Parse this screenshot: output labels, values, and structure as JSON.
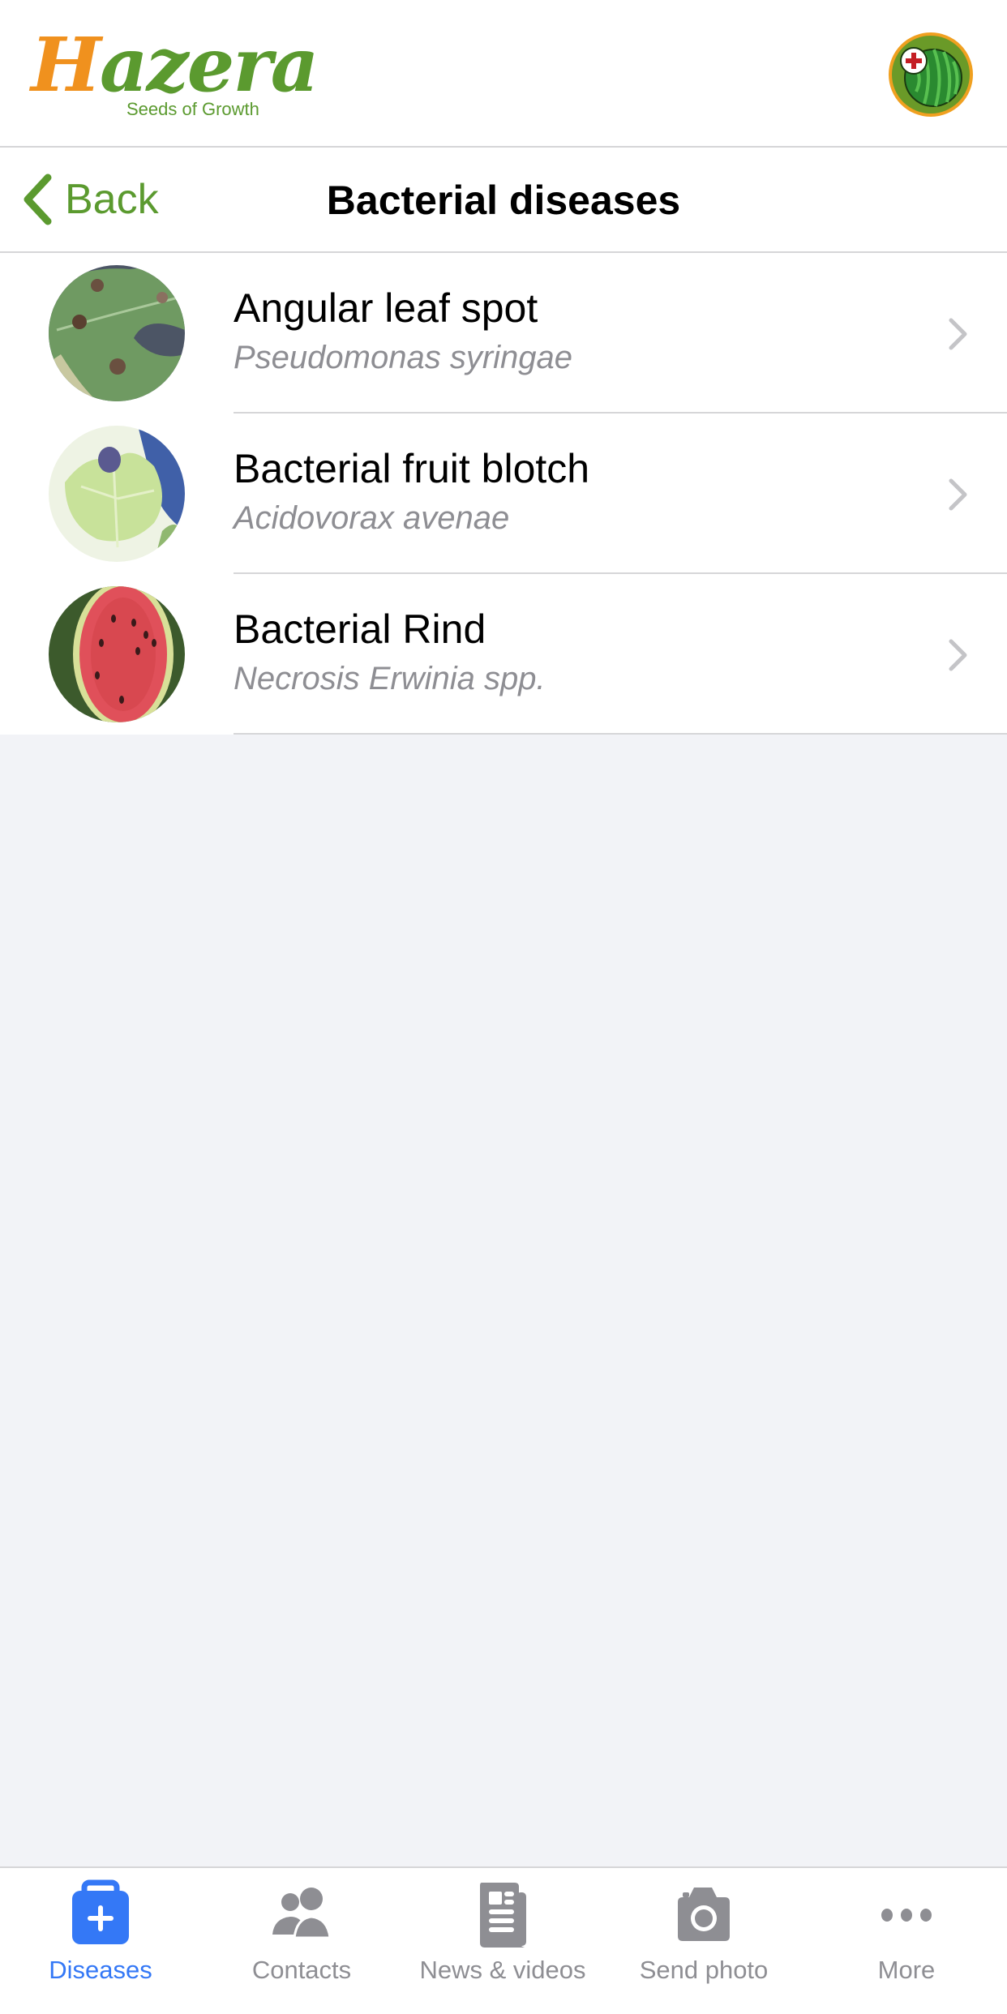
{
  "app": {
    "brand": {
      "logo_initial": "H",
      "logo_rest": "azera",
      "tagline": "Seeds of Growth"
    },
    "colors": {
      "brand_green": "#5b9a2f",
      "brand_orange": "#f0911e",
      "tab_active": "#3478f6",
      "tab_inactive": "#8e8e93"
    },
    "avatar_icon": "watermelon-with-red-cross-icon"
  },
  "navbar": {
    "back_label": "Back",
    "back_icon": "chevron-left-icon",
    "title": "Bacterial diseases"
  },
  "diseases": [
    {
      "name": "Angular leaf spot",
      "pathogen": "Pseudomonas syringae",
      "thumbnail": "leaf-with-spots-photo"
    },
    {
      "name": "Bacterial fruit blotch",
      "pathogen": "Acidovorax avenae",
      "thumbnail": "leaf-with-blotch-photo"
    },
    {
      "name": "Bacterial Rind",
      "pathogen": "Necrosis Erwinia spp.",
      "thumbnail": "cut-watermelon-photo"
    }
  ],
  "tabbar": {
    "active": "Diseases",
    "tabs": [
      {
        "label": "Diseases",
        "icon": "first-aid-kit-icon"
      },
      {
        "label": "Contacts",
        "icon": "people-icon"
      },
      {
        "label": "News & videos",
        "icon": "newspaper-icon"
      },
      {
        "label": "Send photo",
        "icon": "camera-icon"
      },
      {
        "label": "More",
        "icon": "more-dots-icon"
      }
    ]
  }
}
